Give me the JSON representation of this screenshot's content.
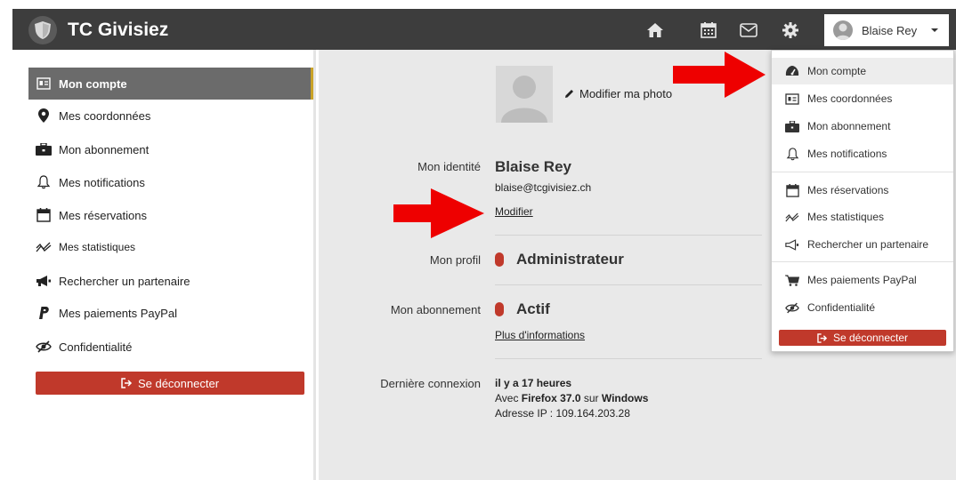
{
  "app": {
    "title": "TC Givisiez"
  },
  "header": {
    "user_name": "Blaise Rey",
    "icons": [
      "home-icon",
      "calendar-icon",
      "mail-icon",
      "gear-icon"
    ]
  },
  "sidebar": {
    "items": [
      {
        "label": "Mon compte",
        "icon": "id-card-icon",
        "active": true
      },
      {
        "label": "Mes coordonnées",
        "icon": "map-marker-icon"
      },
      {
        "label": "Mon abonnement",
        "icon": "briefcase-icon"
      },
      {
        "label": "Mes notifications",
        "icon": "bell-icon"
      },
      {
        "label": "Mes réservations",
        "icon": "calendar-icon"
      },
      {
        "label": "Mes statistiques",
        "icon": "chart-line-icon"
      },
      {
        "label": "Rechercher un partenaire",
        "icon": "megaphone-icon"
      },
      {
        "label": "Mes paiements PayPal",
        "icon": "paypal-icon"
      },
      {
        "label": "Confidentialité",
        "icon": "eye-slash-icon"
      }
    ],
    "logout_label": "Se déconnecter"
  },
  "profile": {
    "photo_link": "Modifier ma photo",
    "identity_label": "Mon identité",
    "name": "Blaise Rey",
    "email": "blaise@tcgivisiez.ch",
    "modify_link": "Modifier",
    "profile_label": "Mon profil",
    "profile_value": "Administrateur",
    "subscription_label": "Mon abonnement",
    "subscription_value": "Actif",
    "more_info_link": "Plus d'informations",
    "last_login_label": "Dernière connexion",
    "last_login_time": "il y a 17 heures",
    "browser_prefix": "Avec ",
    "browser_name": "Firefox 37.0",
    "browser_mid": " sur ",
    "browser_os": "Windows",
    "ip_line": "Adresse IP : 109.164.203.28"
  },
  "dropdown": {
    "items": [
      {
        "label": "Mon compte",
        "icon": "dashboard-icon",
        "active": true
      },
      {
        "label": "Mes coordonnées",
        "icon": "id-card-icon"
      },
      {
        "label": "Mon abonnement",
        "icon": "briefcase-icon"
      },
      {
        "label": "Mes notifications",
        "icon": "bell-icon"
      },
      {
        "label": "Mes réservations",
        "icon": "calendar-icon"
      },
      {
        "label": "Mes statistiques",
        "icon": "chart-line-icon"
      },
      {
        "label": "Rechercher un partenaire",
        "icon": "megaphone-icon"
      },
      {
        "label": "Mes paiements PayPal",
        "icon": "cart-icon"
      },
      {
        "label": "Confidentialité",
        "icon": "eye-slash-icon"
      }
    ],
    "logout_label": "Se déconnecter"
  },
  "colors": {
    "topbar": "#3d3d3d",
    "active_item": "#6b6b6b",
    "accent_red": "#c0392b",
    "arrow_red": "#ee0000",
    "main_bg": "#e9e9e9"
  }
}
